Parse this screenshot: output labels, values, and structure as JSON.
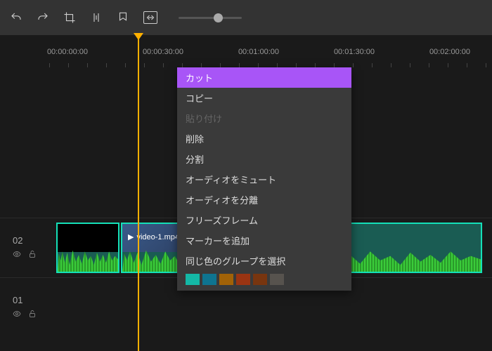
{
  "ruler": {
    "ticks": [
      "00:00:00:00",
      "00:00:30:00",
      "00:01:00:00",
      "00:01:30:00",
      "00:02:00:00"
    ]
  },
  "tracks": [
    {
      "label": "02"
    },
    {
      "label": "01"
    }
  ],
  "clips": [
    {
      "name": "video-1.mp4"
    },
    {
      "name": "video-1.mp4"
    }
  ],
  "contextMenu": {
    "items": [
      {
        "label": "カット",
        "state": "highlighted"
      },
      {
        "label": "コピー",
        "state": "normal"
      },
      {
        "label": "貼り付け",
        "state": "disabled"
      },
      {
        "label": "削除",
        "state": "normal"
      },
      {
        "label": "分割",
        "state": "normal"
      },
      {
        "label": "オーディオをミュート",
        "state": "normal"
      },
      {
        "label": "オーディオを分離",
        "state": "normal"
      },
      {
        "label": "フリーズフレーム",
        "state": "normal"
      },
      {
        "label": "マーカーを追加",
        "state": "normal"
      },
      {
        "label": "同じ色のグループを選択",
        "state": "normal"
      }
    ],
    "colors": [
      "#14b8a6",
      "#0e7490",
      "#a16207",
      "#9a3412",
      "#78350f",
      "#57534e"
    ]
  }
}
